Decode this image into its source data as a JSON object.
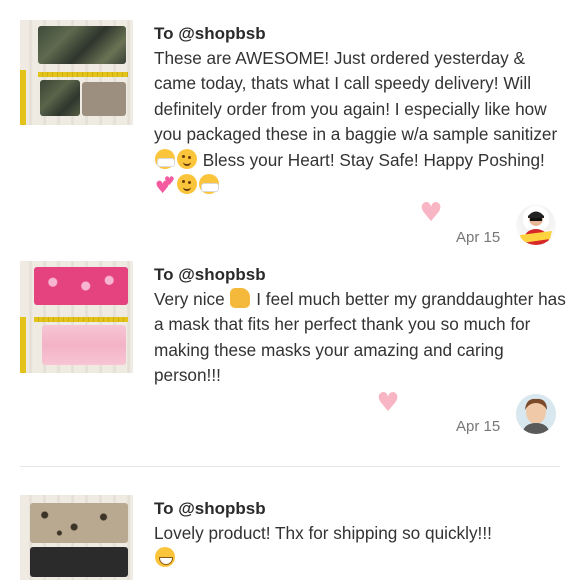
{
  "reviews": [
    {
      "to": "To @shopbsb",
      "segments": [
        "These are AWESOME! Just ordered yesterday & came today, thats what I call speedy delivery! Will definitely order from you again! I especially like how you packaged these in a baggie w/a sample sanitizer ",
        " Bless your Heart! Stay Safe! Happy Poshing! "
      ],
      "date": "Apr 15",
      "emojis": [
        "face-with-medical-mask",
        "winking-face",
        "two-hearts",
        "winking-face",
        "face-with-medical-mask"
      ]
    },
    {
      "to": "To @shopbsb",
      "segments": [
        "Very nice ",
        " I feel much better my granddaughter has a mask that fits her perfect thank you so much for making these masks your amazing and caring person!!!"
      ],
      "date": "Apr 15",
      "emojis": [
        "thumbs-up"
      ]
    },
    {
      "to": "To @shopbsb",
      "segments": [
        "Lovely product! Thx for shipping so quickly!!! "
      ],
      "emojis": [
        "grinning-face"
      ]
    }
  ],
  "colors": {
    "heart": "#f8b6c4",
    "divider": "#e6e6e6",
    "text": "#333333",
    "date": "#777777"
  }
}
